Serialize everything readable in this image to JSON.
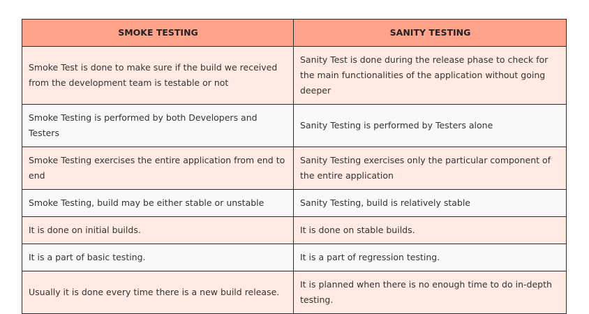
{
  "table": {
    "headers": [
      "SMOKE TESTING",
      "SANITY TESTING"
    ],
    "rows": [
      [
        "Smoke Test is done to make sure if the build we received from the development team is testable or not",
        "Sanity Test is done during the release phase to check for the main functionalities of the application without going deeper"
      ],
      [
        "Smoke Testing is performed by both Developers and Testers",
        "Sanity Testing is performed by Testers alone"
      ],
      [
        "Smoke Testing exercises the entire application from end to end",
        "Sanity Testing exercises only the particular component of the entire application"
      ],
      [
        "Smoke Testing, build may be either stable or unstable",
        "Sanity Testing, build is relatively stable"
      ],
      [
        "It is done on initial builds.",
        "It is done on stable builds."
      ],
      [
        "It is a part of basic testing.",
        "It is a part of regression testing."
      ],
      [
        "Usually it is done every time there is a new build release.",
        "It is planned when there is no enough time to do in-depth testing."
      ]
    ]
  },
  "colors": {
    "header_bg": "#ffa38a",
    "row_odd_bg": "#ffe9e3",
    "row_even_bg": "#f8f8f8",
    "border": "#2b2b2b"
  }
}
